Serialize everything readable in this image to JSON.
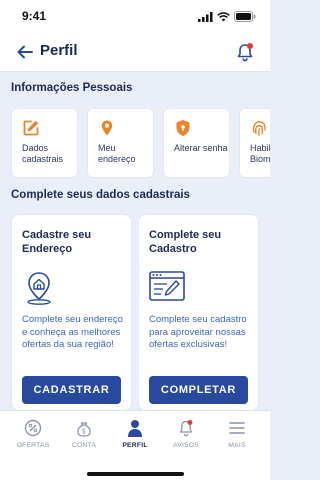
{
  "status_bar": {
    "time": "9:41"
  },
  "header": {
    "title": "Perfil"
  },
  "personal_info": {
    "section_title": "Informações Pessoais",
    "items": [
      {
        "label": "Dados cadastrais",
        "icon": "edit-icon"
      },
      {
        "label": "Meu endereço",
        "icon": "location-pin-icon"
      },
      {
        "label": "Alterar senha",
        "icon": "shield-lock-icon"
      },
      {
        "label": "Habilitar Biometria",
        "icon": "fingerprint-icon"
      }
    ]
  },
  "complete_section": {
    "title": "Complete seus dados cadastrais",
    "cards": [
      {
        "title": "Cadastre seu Endereço",
        "text": "Complete seu endereço e conheça as melhores ofertas da sua região!",
        "button": "CADASTRAR",
        "icon": "address-location-icon"
      },
      {
        "title": "Complete seu Cadastro",
        "text": "Complete seu cadastro para aproveitar nossas ofertas exclusivas!",
        "button": "COMPLETAR",
        "icon": "form-edit-icon"
      }
    ]
  },
  "tabbar": {
    "items": [
      {
        "label": "OFERTAS",
        "icon": "discount-icon"
      },
      {
        "label": "CONTA",
        "icon": "money-bag-icon"
      },
      {
        "label": "PERFIL",
        "icon": "person-icon",
        "active": true
      },
      {
        "label": "AVISOS",
        "icon": "bell-icon"
      },
      {
        "label": "MAIS",
        "icon": "menu-icon"
      }
    ]
  },
  "colors": {
    "primary": "#28499e",
    "accent": "#e8862a",
    "notification": "#e53935",
    "background": "#e9eef8"
  }
}
